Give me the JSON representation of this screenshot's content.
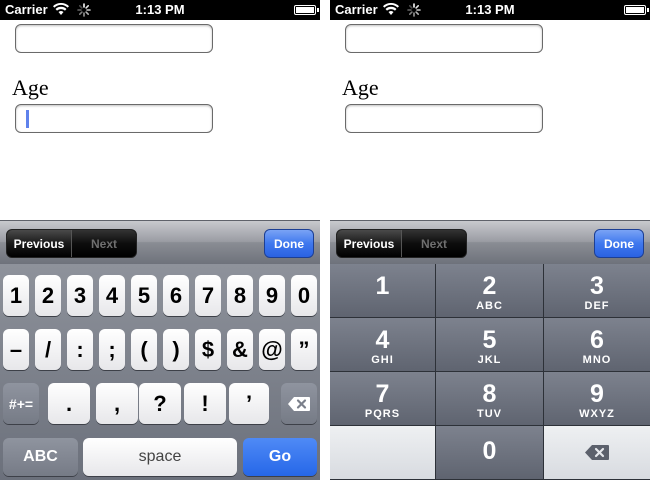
{
  "status_bar": {
    "carrier": "Carrier",
    "time": "1:13 PM"
  },
  "form": {
    "age_label": "Age",
    "field1_value": "",
    "field2_value": ""
  },
  "toolbar": {
    "previous": "Previous",
    "next": "Next",
    "done": "Done"
  },
  "keyboard_symbols": {
    "row1": [
      "1",
      "2",
      "3",
      "4",
      "5",
      "6",
      "7",
      "8",
      "9",
      "0"
    ],
    "row2": [
      "–",
      "/",
      ":",
      ";",
      "(",
      ")",
      "$",
      "&",
      "@",
      "”"
    ],
    "row3_mode": "#+=",
    "row3": [
      ".",
      ",",
      "?",
      "!",
      "’"
    ],
    "abc": "ABC",
    "space": "space",
    "go": "Go"
  },
  "number_pad": {
    "keys": [
      {
        "num": "1",
        "letters": ""
      },
      {
        "num": "2",
        "letters": "ABC"
      },
      {
        "num": "3",
        "letters": "DEF"
      },
      {
        "num": "4",
        "letters": "GHI"
      },
      {
        "num": "5",
        "letters": "JKL"
      },
      {
        "num": "6",
        "letters": "MNO"
      },
      {
        "num": "7",
        "letters": "PQRS"
      },
      {
        "num": "8",
        "letters": "TUV"
      },
      {
        "num": "9",
        "letters": "WXYZ"
      },
      {
        "num": "0",
        "letters": ""
      }
    ]
  }
}
